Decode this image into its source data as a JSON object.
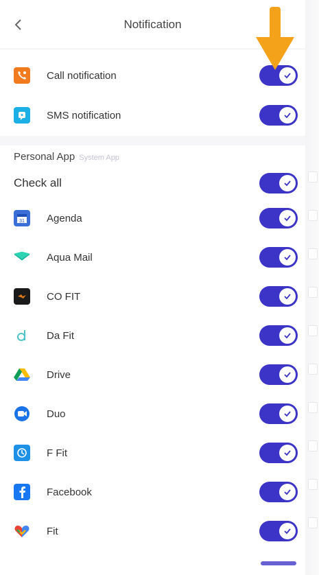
{
  "header": {
    "title": "Notification",
    "back_icon": "chevron-left-icon"
  },
  "top_items": [
    {
      "label": "Call notification",
      "icon": "phone-icon",
      "icon_color": "#f27a1f",
      "enabled": true
    },
    {
      "label": "SMS notification",
      "icon": "sms-icon",
      "icon_color": "#1cb0e6",
      "enabled": true
    }
  ],
  "section": {
    "title": "Personal App",
    "subtitle": "System App"
  },
  "check_all": {
    "label": "Check all",
    "enabled": true
  },
  "apps": [
    {
      "label": "Agenda",
      "icon": "calendar-icon",
      "enabled": true
    },
    {
      "label": "Aqua Mail",
      "icon": "mail-icon",
      "enabled": true
    },
    {
      "label": "CO FIT",
      "icon": "cofit-icon",
      "enabled": true
    },
    {
      "label": "Da Fit",
      "icon": "dafit-icon",
      "enabled": true
    },
    {
      "label": "Drive",
      "icon": "drive-icon",
      "enabled": true
    },
    {
      "label": "Duo",
      "icon": "duo-icon",
      "enabled": true
    },
    {
      "label": "F Fit",
      "icon": "ffit-icon",
      "enabled": true
    },
    {
      "label": "Facebook",
      "icon": "facebook-icon",
      "enabled": true
    },
    {
      "label": "Fit",
      "icon": "heart-icon",
      "enabled": true
    }
  ],
  "colors": {
    "toggle_on": "#3b34c7",
    "arrow": "#f5a21b"
  }
}
